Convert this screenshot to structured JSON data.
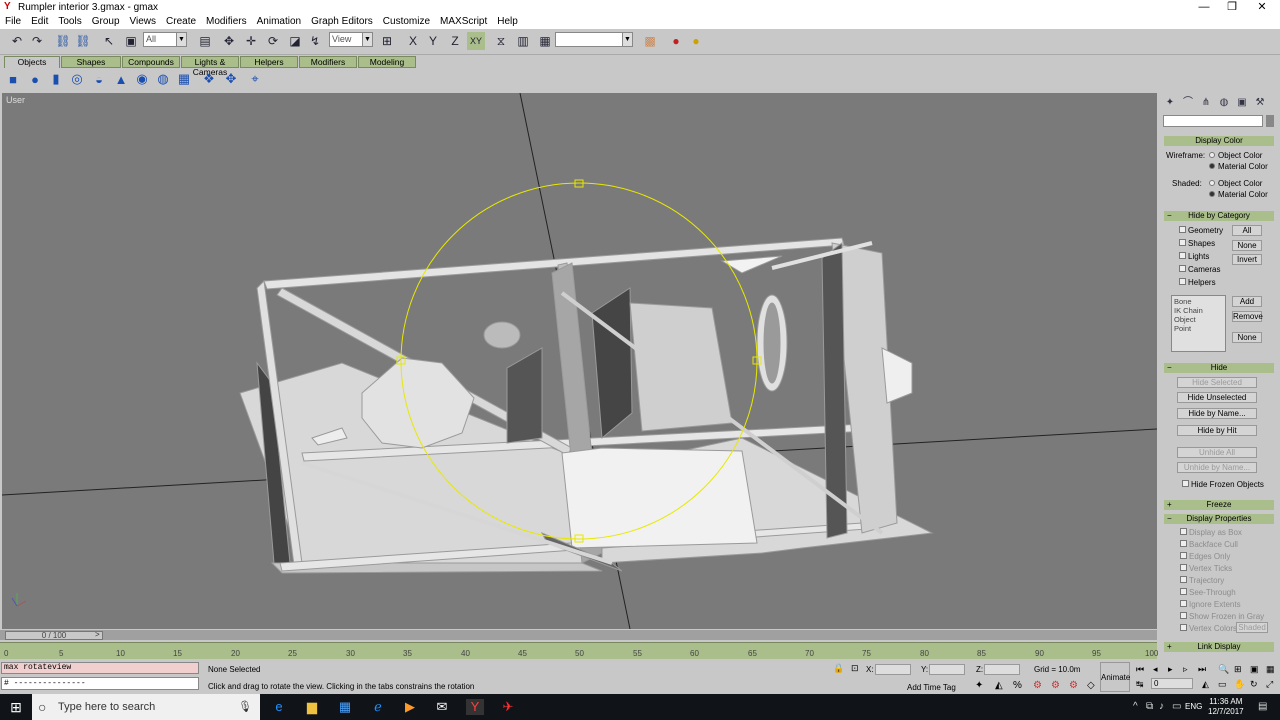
{
  "window": {
    "title": "Rumpler interior 3.gmax - gmax",
    "minimize": "—",
    "maximize": "❐",
    "close": "✕"
  },
  "menu": [
    "File",
    "Edit",
    "Tools",
    "Group",
    "Views",
    "Create",
    "Modifiers",
    "Animation",
    "Graph Editors",
    "Customize",
    "MAXScript",
    "Help"
  ],
  "toolbar": {
    "filter_value": "All",
    "refcoord_value": "View",
    "named_sel_value": ""
  },
  "tabs": [
    "Objects",
    "Shapes",
    "Compounds",
    "Lights & Cameras",
    "Helpers",
    "Modifiers",
    "Modeling"
  ],
  "viewport": {
    "label": "User"
  },
  "panel": {
    "display_color": {
      "title": "Display Color",
      "wireframe": "Wireframe:",
      "shaded": "Shaded:",
      "object_color": "Object Color",
      "material_color": "Material Color"
    },
    "hide_by_category": {
      "title": "Hide by Category",
      "items": [
        "Geometry",
        "Shapes",
        "Lights",
        "Cameras",
        "Helpers"
      ],
      "all": "All",
      "none": "None",
      "invert": "Invert",
      "list": [
        "Bone",
        "IK Chain Object",
        "Point"
      ],
      "add": "Add",
      "remove": "Remove",
      "none2": "None"
    },
    "hide": {
      "title": "Hide",
      "hide_selected": "Hide Selected",
      "hide_unselected": "Hide Unselected",
      "hide_by_name": "Hide by Name...",
      "hide_by_hit": "Hide by Hit",
      "unhide_all": "Unhide All",
      "unhide_by_name": "Unhide by Name...",
      "hide_frozen": "Hide Frozen Objects"
    },
    "freeze": {
      "title": "Freeze"
    },
    "display_props": {
      "title": "Display Properties",
      "items": [
        "Display as Box",
        "Backface Cull",
        "Edges Only",
        "Vertex Ticks",
        "Trajectory",
        "See-Through",
        "Ignore Extents",
        "Show Frozen in Gray",
        "Vertex Colors"
      ],
      "shaded": "Shaded"
    },
    "link_display": {
      "title": "Link Display"
    }
  },
  "timeline": {
    "slider": "0 / 100",
    "ticks": [
      "0",
      "5",
      "10",
      "15",
      "20",
      "25",
      "30",
      "35",
      "40",
      "45",
      "50",
      "55",
      "60",
      "65",
      "70",
      "75",
      "80",
      "85",
      "90",
      "95",
      "100"
    ]
  },
  "status": {
    "maxscript_line": "max rotateview",
    "maxscript_input": "# ---------------",
    "selection": "None Selected",
    "prompt": "Click and drag to rotate the view.  Clicking in the tabs constrains the rotation",
    "x_label": "X:",
    "y_label": "Y:",
    "z_label": "Z:",
    "grid": "Grid = 10.0m",
    "add_time_tag": "Add Time Tag",
    "animate": "Animate",
    "frame": "0"
  },
  "taskbar": {
    "search_placeholder": "Type here to search",
    "time": "11:36 AM",
    "date": "12/7/2017",
    "lang": "ENG"
  }
}
